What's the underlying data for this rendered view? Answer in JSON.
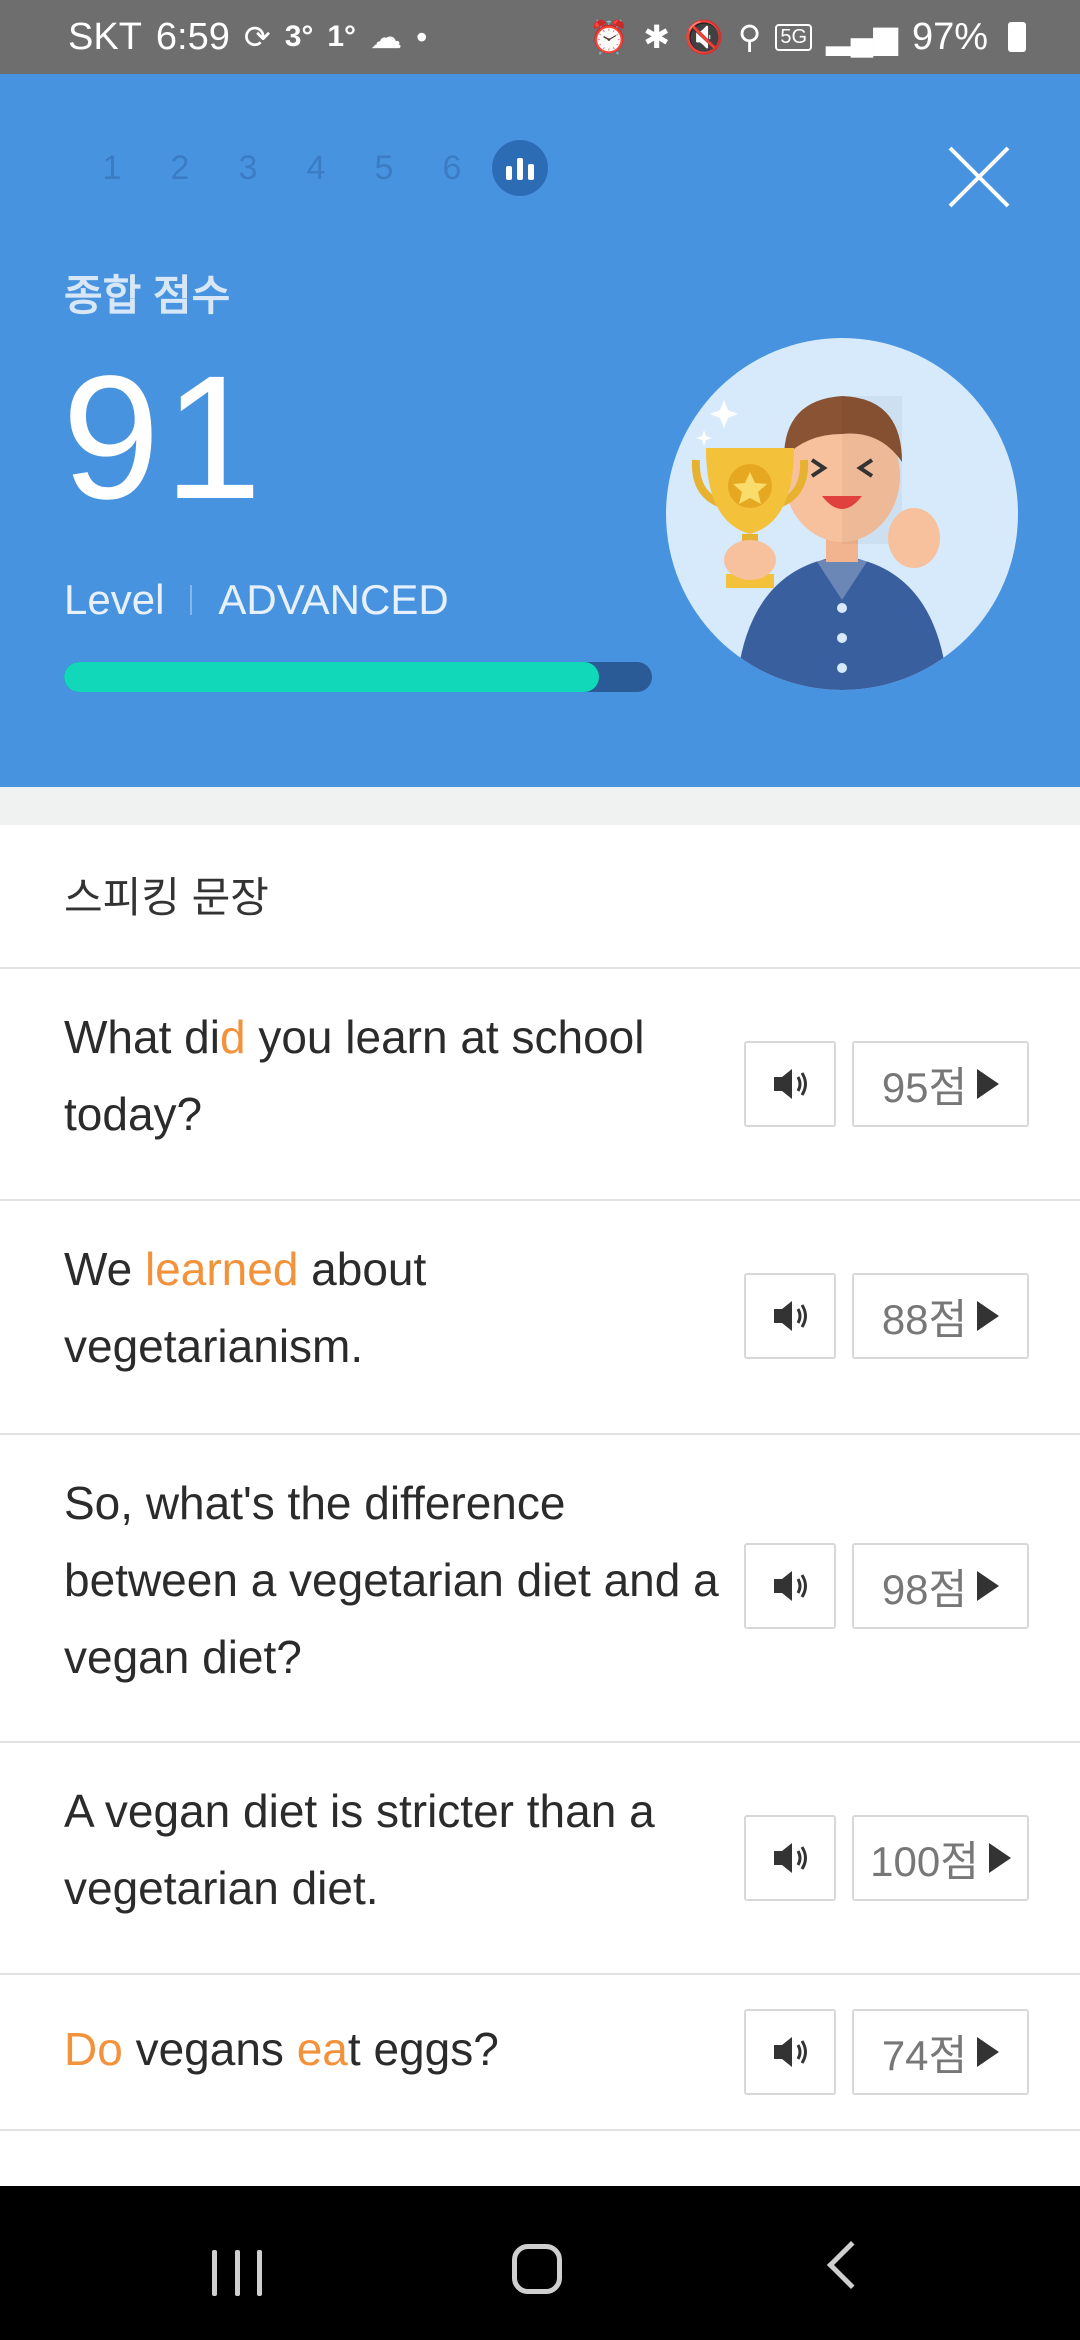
{
  "status_bar": {
    "carrier": "SKT",
    "time": "6:59",
    "temp_high": "3°",
    "temp_low": "1°",
    "network": "5G",
    "battery": "97%"
  },
  "header": {
    "steps": [
      "1",
      "2",
      "3",
      "4",
      "5",
      "6"
    ],
    "active_step_icon": "bar-chart-icon",
    "score_title": "종합 점수",
    "score": "91",
    "level_label": "Level",
    "level_value": "ADVANCED",
    "progress": 0.91,
    "colors": {
      "header_bg": "#4893e0",
      "progress_fill": "#11d8b8",
      "highlight": "#f2923b"
    }
  },
  "section_title": "스피킹 문장",
  "sentences": [
    {
      "segments": [
        {
          "t": "What di",
          "h": false
        },
        {
          "t": "d",
          "h": true
        },
        {
          "t": " you learn at school today?",
          "h": false
        }
      ],
      "score": "95점"
    },
    {
      "segments": [
        {
          "t": "We ",
          "h": false
        },
        {
          "t": "learned",
          "h": true
        },
        {
          "t": " about vegetarianism.",
          "h": false
        }
      ],
      "score": "88점"
    },
    {
      "segments": [
        {
          "t": "So, what's the difference between a vegetarian diet and a vegan diet?",
          "h": false
        }
      ],
      "score": "98점"
    },
    {
      "segments": [
        {
          "t": "A vegan diet is stricter than a vegetarian diet.",
          "h": false
        }
      ],
      "score": "100점"
    },
    {
      "segments": [
        {
          "t": "Do",
          "h": true
        },
        {
          "t": " vegans ",
          "h": false
        },
        {
          "t": "ea",
          "h": true
        },
        {
          "t": "t eggs?",
          "h": false
        }
      ],
      "score": "74점"
    }
  ]
}
